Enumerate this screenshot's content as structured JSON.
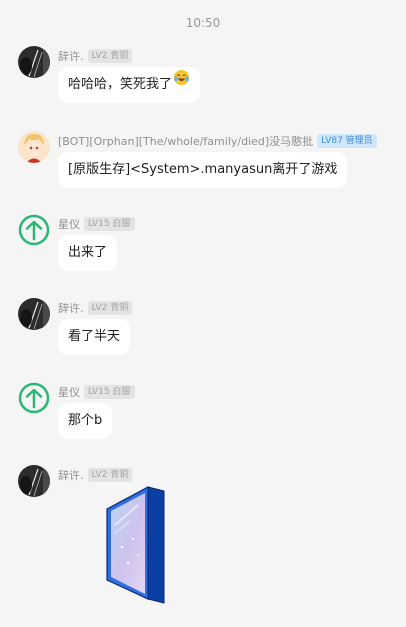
{
  "timestamp": "10:50",
  "colors": {
    "background": "#f5f5f5",
    "bubble": "#ffffff",
    "level_badge_bg": "#e3e3e3",
    "admin_badge_bg": "#cfe6fb",
    "admin_badge_text": "#3f8fd6",
    "arrow_avatar": "#2bb673"
  },
  "messages": [
    {
      "nick": "辞许.",
      "badge": "LV2 青铜",
      "avatar": "dark-portrait-avatar",
      "text": "哈哈哈，笑死我了",
      "emoji": "tears-of-joy-emoji"
    },
    {
      "nick": "[BOT][Orphan][The/whole/family/died]没马憨批",
      "badge": "LV87 管理员",
      "avatar": "anime-character-avatar",
      "text": "[原版生存]<System>.manyasun离开了游戏"
    },
    {
      "nick": "星仪",
      "badge": "LV15 白银",
      "avatar": "green-up-arrow-avatar",
      "text": "出来了"
    },
    {
      "nick": "辞许.",
      "badge": "LV2 青铜",
      "avatar": "dark-portrait-avatar",
      "text": "看了半天"
    },
    {
      "nick": "星仪",
      "badge": "LV15 白银",
      "avatar": "green-up-arrow-avatar",
      "text": "那个b"
    },
    {
      "nick": "辞许.",
      "badge": "LV2 青铜",
      "avatar": "dark-portrait-avatar",
      "sticker": "blue-window-sticker"
    }
  ]
}
